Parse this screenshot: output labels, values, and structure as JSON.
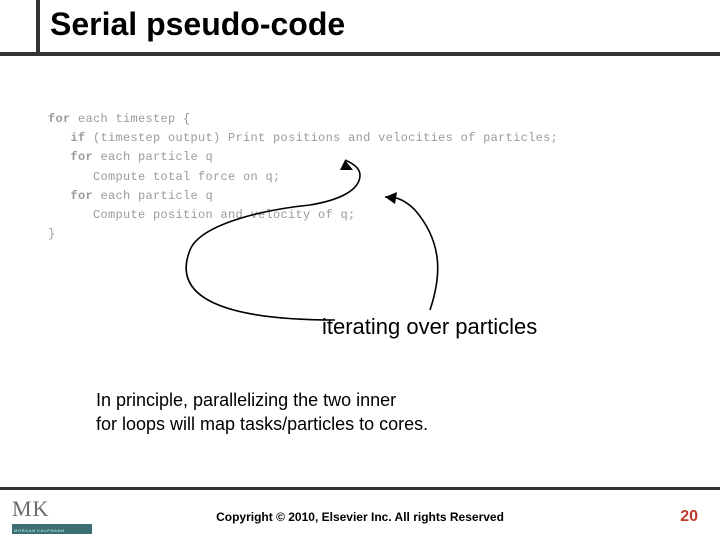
{
  "title": "Serial pseudo-code",
  "code": {
    "l1_kw": "for",
    "l1_rest": " each timestep {",
    "l2_kw": "if",
    "l2_rest": " (timestep output) Print positions and velocities of particles;",
    "l3_kw": "for",
    "l3_rest": " each particle q",
    "l4": "Compute total force on q;",
    "l5_kw": "for",
    "l5_rest": " each particle q",
    "l6": "Compute position and velocity of q;",
    "l7": "}"
  },
  "annotation_caption": "iterating over particles",
  "principle_line1": "In principle, parallelizing the two inner",
  "principle_line2": "for loops will map tasks/particles to cores.",
  "logo_main": "MK",
  "logo_sub": "MORGAN KAUFMANN",
  "copyright": "Copyright © 2010, Elsevier Inc. All rights Reserved",
  "page_number": "20"
}
